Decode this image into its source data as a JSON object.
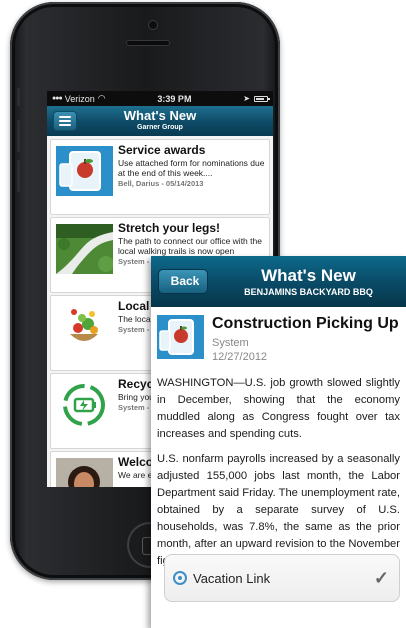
{
  "statusbar": {
    "carrier": "Verizon",
    "time": "3:39 PM"
  },
  "app_header": {
    "title": "What's New",
    "subtitle": "Garner Group"
  },
  "news_items": [
    {
      "title": "Service awards",
      "body": "Use attached form for nominations due at the end of this week....",
      "meta": "Bell, Darius - 05/14/2013",
      "thumb": "tablet-phone-apple-icon"
    },
    {
      "title": "Stretch your legs!",
      "body": "The path to connect our office with the local walking trails is now open",
      "meta": "System -",
      "thumb": "walking-trail-photo"
    },
    {
      "title": "Local s",
      "body": "The local salad bar our empl",
      "meta": "System -",
      "thumb": "salad-bowl-photo"
    },
    {
      "title": "Recyc",
      "body": "Bring you mobile ph electroni",
      "meta": "System -",
      "thumb": "recycle-battery-icon"
    },
    {
      "title": "Welco",
      "body": "We are ex",
      "meta": "",
      "thumb": "woman-portrait-photo"
    }
  ],
  "detail": {
    "back_label": "Back",
    "header_title": "What's New",
    "header_subtitle": "BENJAMINS BACKYARD BBQ",
    "article": {
      "title": "Construction Picking Up",
      "author": "System",
      "date": "12/27/2012",
      "paragraphs": [
        "WASHINGTON—U.S. job growth slowed slightly in December, showing that the economy muddled along as Congress fought over tax increases and spending cuts.",
        "U.S. nonfarm payrolls increased by a seasonally adjusted 155,000 jobs last month, the Labor Department said Friday. The unemployment rate, obtained by a separate survey of U.S. households, was 7.8%, the same as the prior month, after an upward revision to the November figure."
      ]
    },
    "link_label": "Vacation Link"
  },
  "colors": {
    "header_blue": "#0a4c68",
    "back_button": "#2a7ea0",
    "link_icon": "#3f8ec8"
  }
}
